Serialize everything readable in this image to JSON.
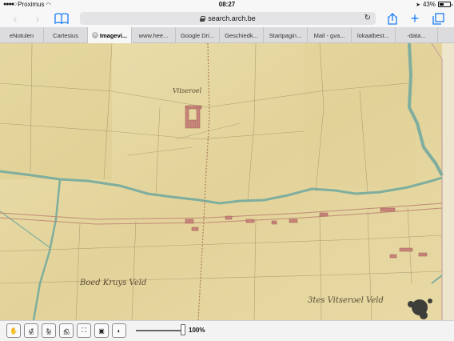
{
  "status_bar": {
    "carrier": "Proximus",
    "time": "08:27",
    "battery_percent": "43%",
    "battery_level": 0.43
  },
  "nav": {
    "url": "search.arch.be"
  },
  "tabs": [
    {
      "label": "eNotulen",
      "active": false
    },
    {
      "label": "Cartesius",
      "active": false
    },
    {
      "label": "Imagevi...",
      "active": true
    },
    {
      "label": "www.hee...",
      "active": false
    },
    {
      "label": "Google Dri...",
      "active": false
    },
    {
      "label": "Geschiedk...",
      "active": false
    },
    {
      "label": "Startpagin...",
      "active": false
    },
    {
      "label": "Mail - gva...",
      "active": false
    },
    {
      "label": "lokaalbest...",
      "active": false
    },
    {
      "label": "-data...",
      "active": false
    }
  ],
  "map_labels": {
    "top_place": "Vitseroel",
    "bottom_left": "Boed Kruys Veld",
    "bottom_right": "3tes Vitseroel Veld"
  },
  "toolbar": {
    "rotate_left_label": "90",
    "rotate_right_label": "90",
    "rotate_180_label": "180",
    "zoom_label": "100%",
    "zoom_level": 1.0
  },
  "colors": {
    "map_paper": "#e8d9a2",
    "map_field": "#dccb8c",
    "river": "#7fae9e",
    "building": "#c8847a",
    "accent": "#1a7cf4"
  }
}
